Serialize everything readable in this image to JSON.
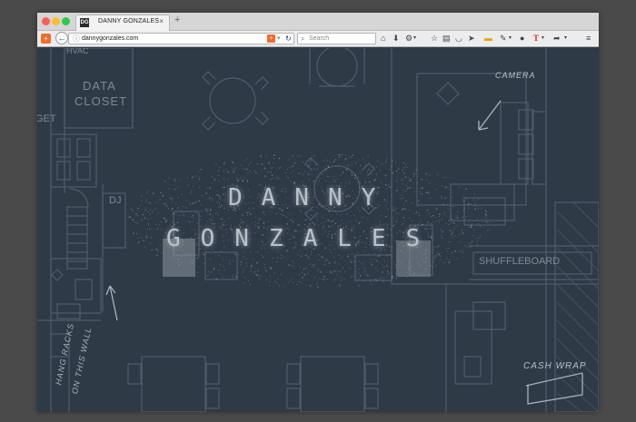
{
  "browser": {
    "tab": {
      "favicon": "DG",
      "title": "DANNY GONZALES"
    },
    "url": "dannygonzales.com",
    "search_placeholder": "Search"
  },
  "floorplan_labels": {
    "hvac": "HVAC",
    "data_closet_1": "DATA",
    "data_closet_2": "CLOSET",
    "dj": "DJ",
    "camera": "CAMERA",
    "shuffleboard": "SHUFFLEBOARD",
    "cash_wrap": "CASH WRAP",
    "hang_racks_1": "HANG RACKS",
    "hang_racks_2": "ON THIS WALL",
    "left_edge_fragment": "GET"
  },
  "hero": {
    "line1": "DANNY",
    "line2": "GONZALES"
  },
  "icons": {
    "toolbar": [
      "home-icon",
      "download-icon",
      "settings-icon",
      "star-icon",
      "clipboard-icon",
      "pocket-icon",
      "send-icon",
      "note-icon",
      "eyedropper-icon",
      "chat-icon",
      "font-icon",
      "menu-icon"
    ]
  }
}
